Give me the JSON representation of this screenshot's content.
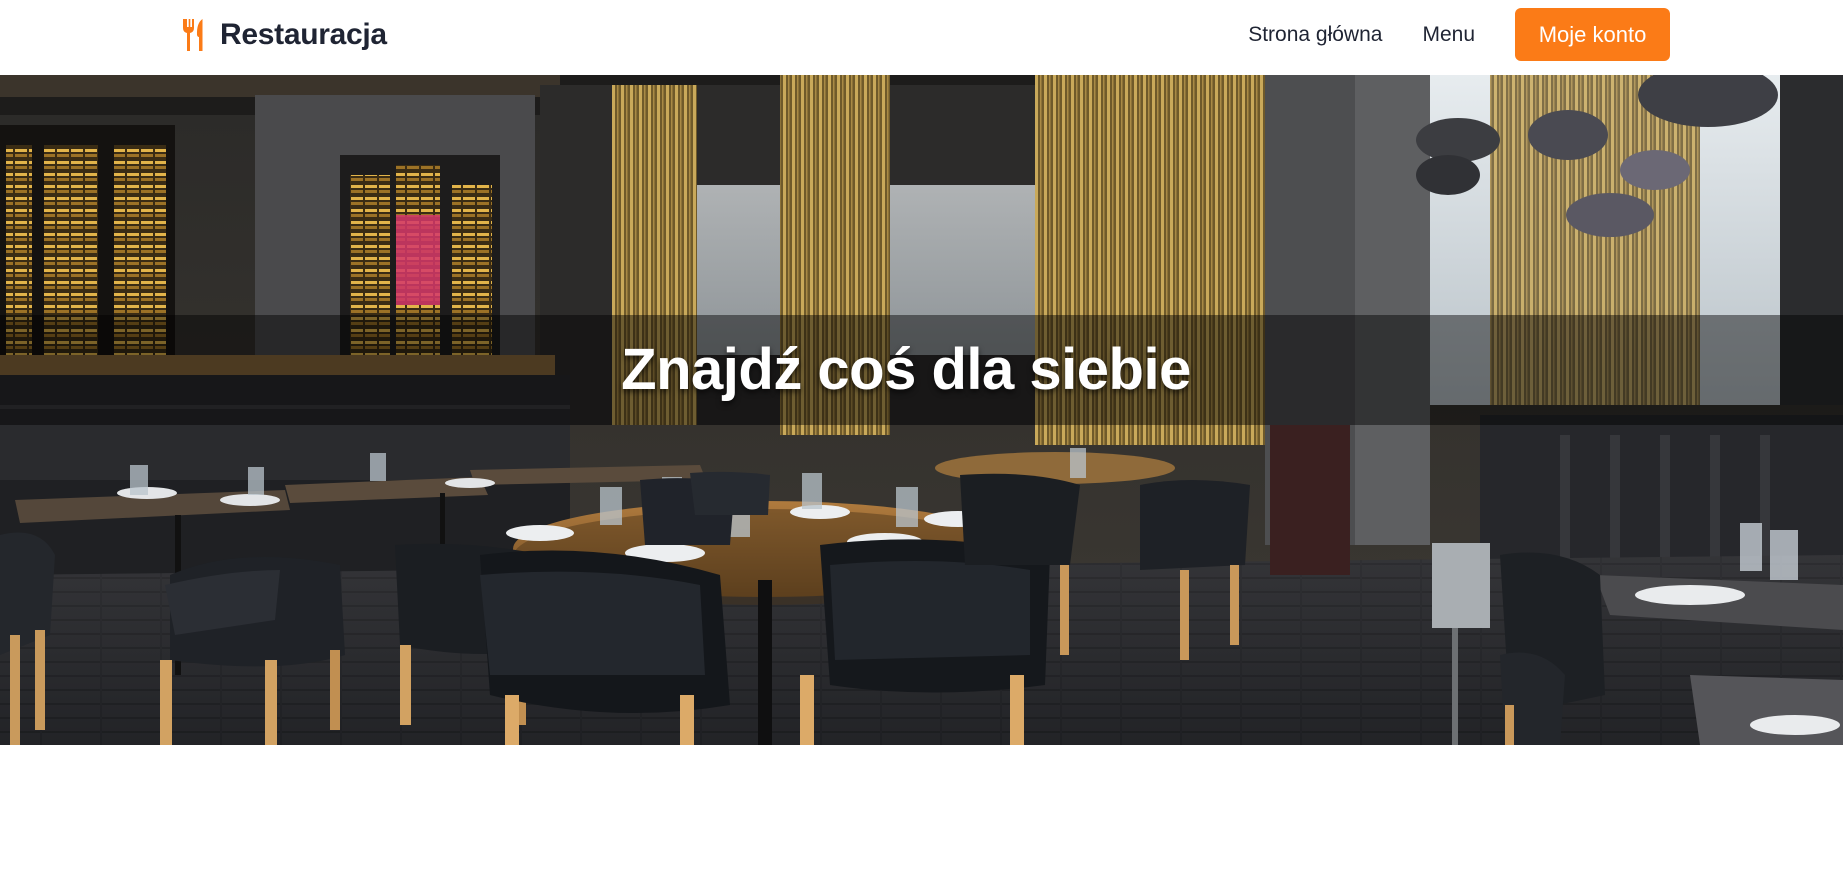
{
  "brand": {
    "name": "Restauracja",
    "icon": "utensils-icon"
  },
  "nav": {
    "home_label": "Strona główna",
    "menu_label": "Menu",
    "account_label": "Moje konto"
  },
  "hero": {
    "title": "Znajdź coś dla siebie",
    "image": "restaurant-interior-photo"
  },
  "colors": {
    "accent": "#fb7b17",
    "text_dark": "#1f2433",
    "background": "#ffffff"
  }
}
